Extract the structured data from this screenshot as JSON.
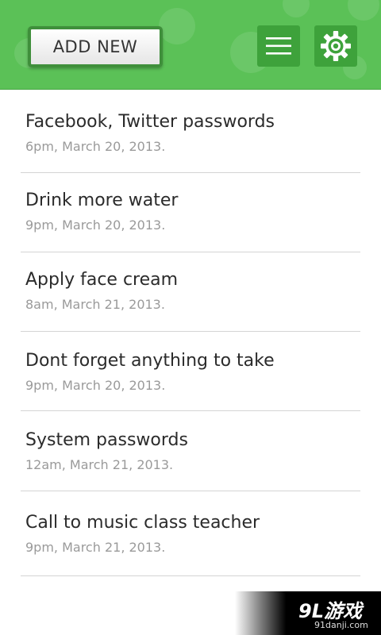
{
  "header": {
    "add_button_label": "ADD NEW",
    "menu_icon": "hamburger-menu-icon",
    "settings_icon": "gear-icon",
    "background_color": "#5bc157",
    "button_color": "#3ea23b"
  },
  "reminders": [
    {
      "title": "Facebook, Twitter passwords",
      "date": "6pm, March 20, 2013."
    },
    {
      "title": "Drink more water",
      "date": "9pm, March 20, 2013."
    },
    {
      "title": "Apply face cream",
      "date": "8am, March 21, 2013."
    },
    {
      "title": "Dont forget anything to take",
      "date": "9pm, March 20, 2013."
    },
    {
      "title": "System passwords",
      "date": "12am, March 21, 2013."
    },
    {
      "title": "Call to music class teacher",
      "date": "9pm, March 21, 2013."
    }
  ],
  "watermark": {
    "logo": "9L游戏",
    "url": "91danji.com"
  }
}
